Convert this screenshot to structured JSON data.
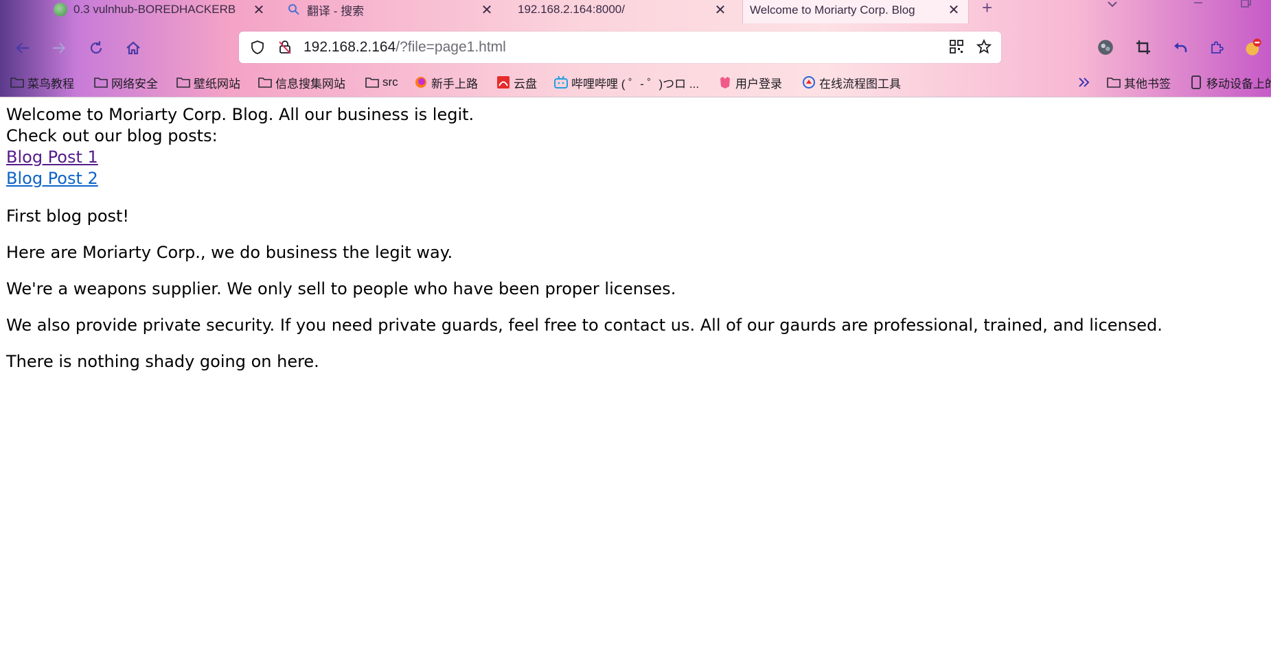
{
  "tabs": [
    {
      "title": "0.3 vulnhub-BOREDHACKERB",
      "close": "✕"
    },
    {
      "title": "翻译 - 搜索",
      "close": "✕"
    },
    {
      "title": "192.168.2.164:8000/",
      "close": "✕"
    },
    {
      "title": "Welcome to Moriarty Corp. Blog",
      "close": "✕"
    }
  ],
  "new_tab": "+",
  "address": {
    "host": "192.168.2.164",
    "path": "/?file=page1.html"
  },
  "bookmarks": [
    {
      "label": "菜鸟教程",
      "icon": "folder-icon"
    },
    {
      "label": "网络安全",
      "icon": "folder-icon"
    },
    {
      "label": "壁纸网站",
      "icon": "folder-icon"
    },
    {
      "label": "信息搜集网站",
      "icon": "folder-icon"
    },
    {
      "label": "src",
      "icon": "folder-icon"
    },
    {
      "label": "新手上路",
      "icon": "firefox-icon"
    },
    {
      "label": "云盘",
      "icon": "cloud-icon"
    },
    {
      "label": "哔哩哔哩 ( ゜- ゜)つロ ...",
      "icon": "bilibili-icon"
    },
    {
      "label": "用户登录",
      "icon": "login-icon"
    },
    {
      "label": "在线流程图工具",
      "icon": "flowchart-icon"
    },
    {
      "label": "其他书签",
      "icon": "folder-icon"
    },
    {
      "label": "移动设备上的",
      "icon": "mobile-icon"
    }
  ],
  "page": {
    "intro_line1": "Welcome to Moriarty Corp. Blog. All our business is legit.",
    "intro_line2": "Check out our blog posts:",
    "link1": "Blog Post 1",
    "link2": "Blog Post 2",
    "paragraphs": [
      "First blog post!",
      "Here are Moriarty Corp., we do business the legit way.",
      "We're a weapons supplier. We only sell to people who have been proper licenses.",
      "We also provide private security. If you need private guards, feel free to contact us. All of our gaurds are professional, trained, and licensed.",
      "There is nothing shady going on here."
    ]
  },
  "colors": {
    "link": "#0c63c7",
    "link_visited": "#551a8b",
    "accent": "#6a3fb5"
  }
}
